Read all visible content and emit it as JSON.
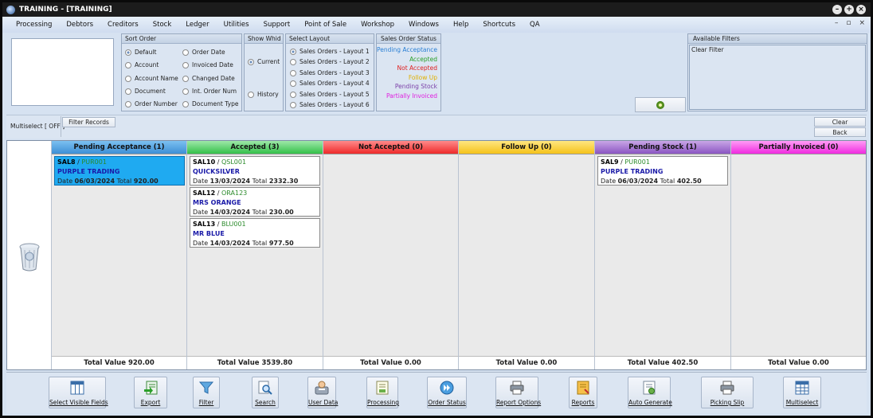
{
  "window": {
    "title": "TRAINING - [TRAINING]",
    "controls": [
      "–",
      "+",
      "×"
    ]
  },
  "menu": [
    "Processing",
    "Debtors",
    "Creditors",
    "Stock",
    "Ledger",
    "Utilities",
    "Support",
    "Point of Sale",
    "Workshop",
    "Windows",
    "Help",
    "Shortcuts",
    "QA"
  ],
  "mdi_controls": [
    "–",
    "▫",
    "×"
  ],
  "sort_order": {
    "title": "Sort Order",
    "options": [
      "Default",
      "Order Date",
      "Account",
      "Invoiced Date",
      "Account Name",
      "Changed Date",
      "Document",
      "Int. Order Num",
      "Order Number",
      "Document Type"
    ],
    "selected": "Default"
  },
  "show_which": {
    "title": "Show Whid",
    "options": [
      "Current",
      "History"
    ],
    "selected": "Current"
  },
  "select_layout": {
    "title": "Select Layout",
    "options": [
      "Sales Orders - Layout 1",
      "Sales Orders - Layout 2",
      "Sales Orders - Layout 3",
      "Sales Orders - Layout 4",
      "Sales Orders - Layout 5",
      "Sales Orders - Layout 6"
    ],
    "selected": "Sales Orders - Layout 1"
  },
  "status_legend": {
    "title": "Sales Order Status",
    "items": [
      {
        "label": "Pending Acceptance",
        "color": "#2a7fd4"
      },
      {
        "label": "Accepted",
        "color": "#2aa02a"
      },
      {
        "label": "Not Accepted",
        "color": "#e02020"
      },
      {
        "label": "Follow Up",
        "color": "#e0b000"
      },
      {
        "label": "Pending Stock",
        "color": "#7a3fa8"
      },
      {
        "label": "Partially Invoiced",
        "color": "#e020e0"
      }
    ]
  },
  "filters": {
    "title": "Available Filters",
    "clear_label": "Clear Filter"
  },
  "multiselect_status": "Multiselect [ OFF ]",
  "filter_records_label": "Filter Records",
  "clear_label": "Clear",
  "back_label": "Back",
  "columns": [
    {
      "title": "Pending Acceptance (1)",
      "color_top": "#7cc0f0",
      "color_bottom": "#3d8fd6",
      "total": "Total Value 920.00",
      "cards": [
        {
          "ref": "SAL8",
          "account": "PUR001",
          "name": "PURPLE TRADING",
          "date": "06/03/2024",
          "total": "920.00",
          "selected": true
        }
      ]
    },
    {
      "title": "Accepted (3)",
      "color_top": "#9ee8a8",
      "color_bottom": "#34c04a",
      "total": "Total Value 3539.80",
      "cards": [
        {
          "ref": "SAL10",
          "account": "QSL001",
          "name": "QUICKSILVER",
          "date": "13/03/2024",
          "total": "2332.30",
          "selected": false
        },
        {
          "ref": "SAL12",
          "account": "ORA123",
          "name": "MRS ORANGE",
          "date": "14/03/2024",
          "total": "230.00",
          "selected": false
        },
        {
          "ref": "SAL13",
          "account": "BLU001",
          "name": "MR BLUE",
          "date": "14/03/2024",
          "total": "977.50",
          "selected": false
        }
      ]
    },
    {
      "title": "Not Accepted (0)",
      "color_top": "#ff8a8a",
      "color_bottom": "#ee2a2a",
      "total": "Total Value 0.00",
      "cards": []
    },
    {
      "title": "Follow Up (0)",
      "color_top": "#ffe680",
      "color_bottom": "#f5c21a",
      "total": "Total Value 0.00",
      "cards": []
    },
    {
      "title": "Pending Stock (1)",
      "color_top": "#c9a6e6",
      "color_bottom": "#8a55c2",
      "total": "Total Value 402.50",
      "cards": [
        {
          "ref": "SAL9",
          "account": "PUR001",
          "name": "PURPLE TRADING",
          "date": "06/03/2024",
          "total": "402.50",
          "selected": false
        }
      ]
    },
    {
      "title": "Partially Invoiced (0)",
      "color_top": "#ff9cf5",
      "color_bottom": "#f02ae0",
      "total": "Total Value 0.00",
      "cards": []
    }
  ],
  "card_labels": {
    "date": "Date",
    "total": "Total"
  },
  "toolbar": [
    {
      "label": "Select Visible Fields",
      "icon": "columns-icon"
    },
    {
      "label": "Export",
      "icon": "export-icon"
    },
    {
      "label": "Filter",
      "icon": "funnel-icon"
    },
    {
      "label": "Search",
      "icon": "search-icon"
    },
    {
      "label": "User Data",
      "icon": "user-data-icon"
    },
    {
      "label": "Processing",
      "icon": "processing-icon"
    },
    {
      "label": "Order Status",
      "icon": "order-status-icon"
    },
    {
      "label": "Report Options",
      "icon": "printer-icon"
    },
    {
      "label": "Reports",
      "icon": "reports-icon"
    },
    {
      "label": "Auto Generate",
      "icon": "auto-generate-icon"
    },
    {
      "label": "Picking Slip",
      "icon": "printer-icon"
    },
    {
      "label": "Multiselect",
      "icon": "grid-icon"
    }
  ]
}
